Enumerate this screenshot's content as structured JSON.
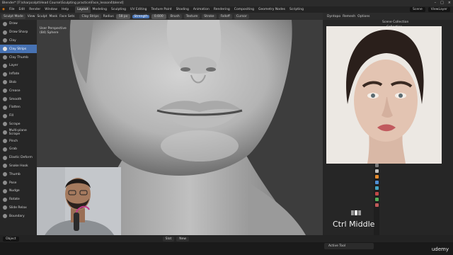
{
  "window": {
    "title": "Blender* [F:\\sharpcolpt\\Head Course\\Sculpting practice\\Face_lesson4\\blend]"
  },
  "menubar": {
    "items": [
      "File",
      "Edit",
      "Render",
      "Window",
      "Help"
    ],
    "workspaces": [
      "Layout",
      "Modeling",
      "Sculpting",
      "UV Editing",
      "Texture Paint",
      "Shading",
      "Animation",
      "Rendering",
      "Compositing",
      "Geometry Nodes",
      "Scripting"
    ],
    "active_workspace": "Layout",
    "scene": "Scene",
    "view_layer": "ViewLayer"
  },
  "viewport_header": {
    "mode": "Sculpt Mode",
    "view": "View",
    "sculpt": "Sculpt",
    "mask": "Mask",
    "face_sets": "Face Sets",
    "brush_name": "Clay Strips",
    "radius_label": "Radius",
    "radius_value": "58 px",
    "strength_label": "Strength",
    "strength_value": "0.600",
    "brush_menu": "Brush",
    "texture_menu": "Texture",
    "stroke_menu": "Stroke",
    "falloff_menu": "Falloff",
    "cursor_menu": "Cursor"
  },
  "viewport": {
    "perspective": "User Perspective",
    "object": "(84) Sphere"
  },
  "toolbar": {
    "tools": [
      "Draw",
      "Draw Sharp",
      "Clay",
      "Clay Strips",
      "Clay Thumb",
      "Layer",
      "Inflate",
      "Blob",
      "Crease",
      "Smooth",
      "Flatten",
      "Fill",
      "Scrape",
      "Multi-plane Scrape",
      "Pinch",
      "Grab",
      "Elastic Deform",
      "Snake Hook",
      "Thumb",
      "Pose",
      "Nudge",
      "Rotate",
      "Slide Relax",
      "Boundary"
    ],
    "active_tool": "Clay Strips"
  },
  "right_panel": {
    "dyntopo": "Dyntopo",
    "remesh": "Remesh",
    "options": "Options",
    "outliner_title": "Scene Collection",
    "outliner_item": "Collection"
  },
  "status_bar": {
    "object": "Object"
  },
  "bottom_bar": {
    "shading": "Slot",
    "new_label": "New",
    "active_tool": "Active Tool"
  },
  "overlay": {
    "key_hint": "Ctrl Middle",
    "watermark": "udemy"
  },
  "colors": {
    "accent": "#4772b3",
    "background": "#1d1d1d",
    "panel": "#262626",
    "viewport": "#3d3d3d"
  }
}
